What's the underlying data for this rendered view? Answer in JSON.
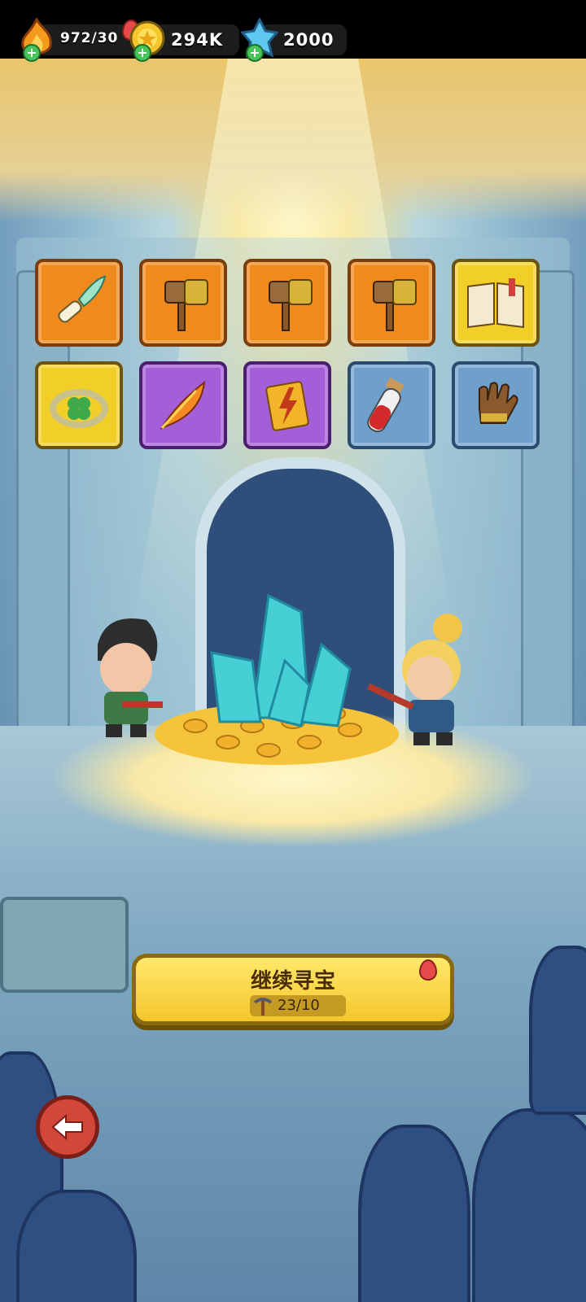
{
  "currencies": [
    {
      "icon": "energy-flame-icon",
      "value": "972/30"
    },
    {
      "icon": "gold-coin-icon",
      "value": "294K"
    },
    {
      "icon": "blue-gem-icon",
      "value": "2000"
    }
  ],
  "items": [
    {
      "icon": "feather-scroll-icon",
      "rarity": "orange"
    },
    {
      "icon": "hammer-icon",
      "rarity": "orange"
    },
    {
      "icon": "hammer-icon",
      "rarity": "orange"
    },
    {
      "icon": "hammer-icon",
      "rarity": "orange"
    },
    {
      "icon": "spellbook-icon",
      "rarity": "yellow"
    },
    {
      "icon": "clover-ring-icon",
      "rarity": "yellow"
    },
    {
      "icon": "phoenix-feather-icon",
      "rarity": "purple"
    },
    {
      "icon": "lightning-scroll-icon",
      "rarity": "purple"
    },
    {
      "icon": "red-potion-icon",
      "rarity": "blue"
    },
    {
      "icon": "leather-glove-icon",
      "rarity": "blue"
    }
  ],
  "continue_button": {
    "label": "继续寻宝",
    "count": "23/10",
    "icon": "pickaxe-icon"
  },
  "back_button": {
    "icon": "back-arrow-icon"
  }
}
